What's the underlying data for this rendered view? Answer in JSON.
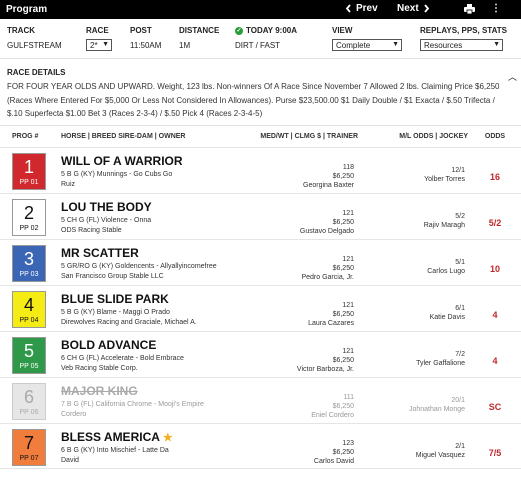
{
  "window": {
    "title": "Program",
    "prev_label": "Prev",
    "next_label": "Next",
    "prev_icon": "chevron-left-icon",
    "next_icon": "chevron-right-icon",
    "print_icon": "print-icon",
    "menu_icon": "more-icon"
  },
  "filters": {
    "track_label": "TRACK",
    "track_value": "GULFSTREAM",
    "race_label": "RACE",
    "race_value": "2*",
    "post_label": "POST",
    "post_value": "11:50AM",
    "distance_label": "DISTANCE",
    "distance_value": "1M",
    "today_label": "TODAY 9:00A",
    "today_value": "DIRT / FAST",
    "view_label": "VIEW",
    "view_value": "Complete",
    "replays_label": "REPLAYS, PPS, STATS",
    "replays_value": "Resources"
  },
  "details": {
    "title": "RACE DETAILS",
    "text": "FOR FOUR YEAR OLDS AND UPWARD. Weight, 123 lbs. Non-winners Of A Race Since November 7 Allowed 2 lbs. Claiming Price $6,250 (Races Where Entered For $5,000 Or Less Not Considered In Allowances). Purse $23,500.00 $1 Daily Double / $1 Exacta / $.50 Trifecta / $.10 Superfecta $1.00 Bet 3 (Races 2-3-4) / $.50 Pick 4 (Races 2-3-4-5)"
  },
  "columns": {
    "prog": "PROG #",
    "horse": "HORSE | BREED SIRE-DAM | OWNER",
    "med": "MED/WT | CLMG $ | TRAINER",
    "ml": "M/L ODDS | JOCKEY",
    "odds": "ODDS"
  },
  "horses": [
    {
      "num": "1",
      "pp": "PP 01",
      "name": "WILL OF A WARRIOR",
      "breed": "5 B G (KY) Munnings - Go Cubs Go",
      "owner": "Ruiz",
      "wt": "118",
      "clmg": "$6,250",
      "trainer": "Georgina Baxter",
      "ml": "12/1",
      "jockey": "Yolber Torres",
      "odds": "16",
      "bg": "#d0282d",
      "fg": "#ffffff"
    },
    {
      "num": "2",
      "pp": "PP 02",
      "name": "LOU THE BODY",
      "breed": "5 CH G (FL) Violence - Onna",
      "owner": "ODS Racing Stable",
      "wt": "121",
      "clmg": "$6,250",
      "trainer": "Gustavo Delgado",
      "ml": "5/2",
      "jockey": "Rajiv Maragh",
      "odds": "5/2",
      "bg": "#ffffff",
      "fg": "#111111"
    },
    {
      "num": "3",
      "pp": "PP 03",
      "name": "MR SCATTER",
      "breed": "5 GR/RO G (KY) Goldencents - Allyallyincomefree",
      "owner": "San Francisco Group Stable LLC",
      "wt": "121",
      "clmg": "$6,250",
      "trainer": "Pedro Garcia, Jr.",
      "ml": "5/1",
      "jockey": "Carlos Lugo",
      "odds": "10",
      "bg": "#3a66b5",
      "fg": "#ffffff"
    },
    {
      "num": "4",
      "pp": "PP 04",
      "name": "BLUE SLIDE PARK",
      "breed": "5 B G (KY) Blame - Maggi O Prado",
      "owner": "Direwolves Racing and Graciale, Michael A.",
      "wt": "121",
      "clmg": "$6,250",
      "trainer": "Laura Cazares",
      "ml": "6/1",
      "jockey": "Katie Davis",
      "odds": "4",
      "bg": "#f5ec16",
      "fg": "#111111"
    },
    {
      "num": "5",
      "pp": "PP 05",
      "name": "BOLD ADVANCE",
      "breed": "6 CH G (FL) Accelerate - Bold Embrace",
      "owner": "Veb Racing Stable Corp.",
      "wt": "121",
      "clmg": "$6,250",
      "trainer": "Victor Barboza, Jr.",
      "ml": "7/2",
      "jockey": "Tyler Gaffalione",
      "odds": "4",
      "bg": "#2e9a49",
      "fg": "#ffffff"
    },
    {
      "num": "6",
      "pp": "PP 06",
      "name": "MAJOR KING",
      "breed": "7 B G (FL) California Chrome - Mooji's Empire",
      "owner": "Cordero",
      "wt": "111",
      "clmg": "$6,250",
      "trainer": "Eniel Cordero",
      "ml": "20/1",
      "jockey": "Johnathan Monge",
      "odds": "SC",
      "bg": "#e6e6e6",
      "fg": "#aaaaaa",
      "scratched": true
    },
    {
      "num": "7",
      "pp": "PP 07",
      "name": "BLESS AMERICA",
      "breed": "6 B G (KY) Into Mischief - Latte Da",
      "owner": "David",
      "wt": "123",
      "clmg": "$6,250",
      "trainer": "Carlos David",
      "ml": "2/1",
      "jockey": "Miguel Vasquez",
      "odds": "7/5",
      "bg": "#f07d3c",
      "fg": "#111111",
      "star": true
    }
  ]
}
